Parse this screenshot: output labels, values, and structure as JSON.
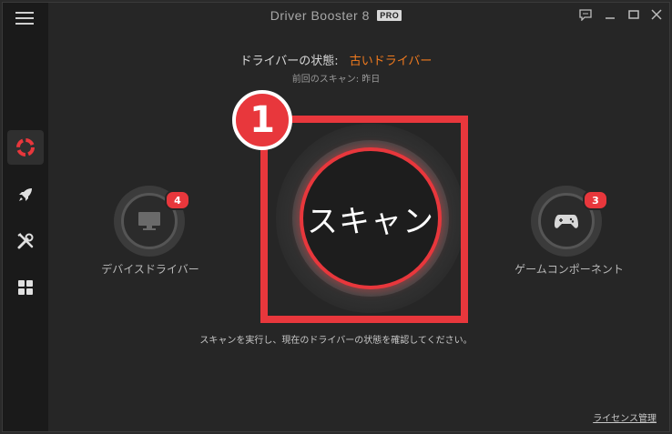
{
  "titlebar": {
    "title": "Driver Booster 8",
    "badge": "PRO"
  },
  "status": {
    "label": "ドライバーの状態:",
    "value": "古いドライバー",
    "value_color": "#f07a1e",
    "last_scan": "前回のスキャン: 昨日"
  },
  "scan": {
    "button_label": "スキャン",
    "step_number": "1",
    "accent_color": "#e8373c"
  },
  "devices": {
    "left": {
      "label": "デバイスドライバー",
      "count": "4",
      "icon": "monitor-icon"
    },
    "right": {
      "label": "ゲームコンポーネント",
      "count": "3",
      "icon": "gamepad-icon"
    }
  },
  "hint": "スキャンを実行し、現在のドライバーの状態を確認してください。",
  "footer": {
    "license_link": "ライセンス管理"
  },
  "sidebar": {
    "items": [
      {
        "name": "scan",
        "icon": "lifebuoy-icon",
        "active": true
      },
      {
        "name": "boost",
        "icon": "rocket-icon",
        "active": false
      },
      {
        "name": "tools",
        "icon": "tools-icon",
        "active": false
      },
      {
        "name": "action-center",
        "icon": "grid-icon",
        "active": false
      }
    ]
  }
}
